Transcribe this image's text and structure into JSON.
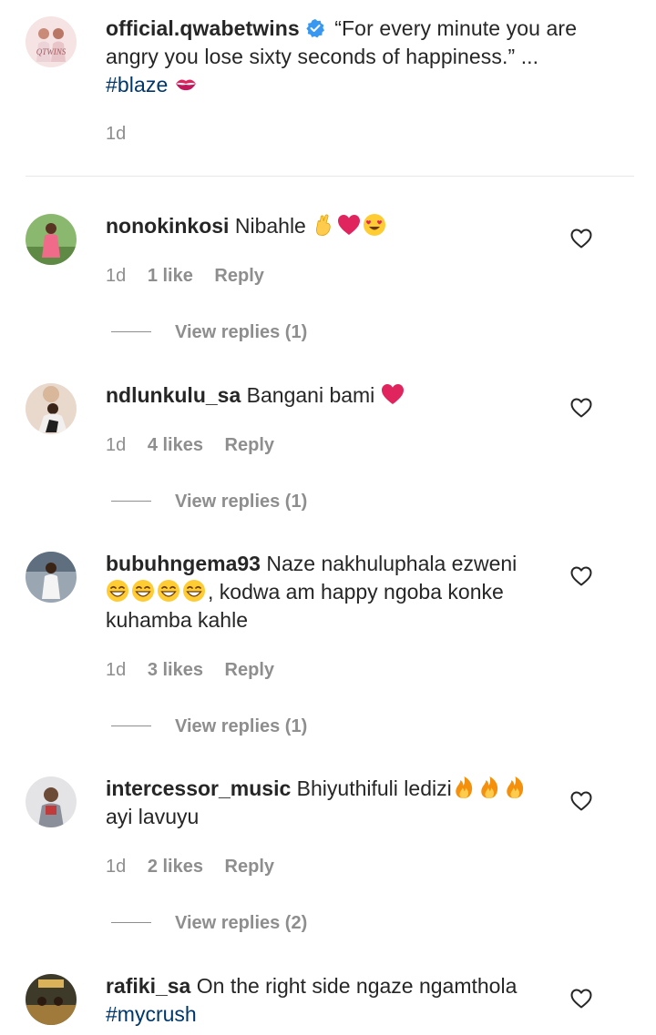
{
  "caption": {
    "username": "official.qwabetwins",
    "text": "“For every minute you are angry you lose sixty seconds of happiness.” ...",
    "hashtag": "#blaze",
    "time": "1d",
    "avatar_text": "QTWINS"
  },
  "comments": [
    {
      "username": "nonokinkosi",
      "text": "Nibahle",
      "emojis": [
        "crossed-fingers",
        "red-heart",
        "heart-eyes"
      ],
      "time": "1d",
      "likes": "1 like",
      "reply": "Reply",
      "view_replies": "View replies (1)"
    },
    {
      "username": "ndlunkulu_sa",
      "text": "Bangani bami",
      "emojis": [
        "red-heart"
      ],
      "time": "1d",
      "likes": "4 likes",
      "reply": "Reply",
      "view_replies": "View replies (1)"
    },
    {
      "username": "bubuhngema93",
      "text": "Naze nakhuluphala ezweni",
      "text2": ", kodwa am happy ngoba konke kuhamba kahle",
      "emojis": [
        "grinning-sweat",
        "grinning-sweat",
        "grinning-sweat",
        "grinning-sweat"
      ],
      "time": "1d",
      "likes": "3 likes",
      "reply": "Reply",
      "view_replies": "View replies (1)"
    },
    {
      "username": "intercessor_music",
      "text": "Bhiyuthifuli ledizi",
      "text2": "ayi lavuyu",
      "emojis": [
        "fire",
        "fire",
        "fire"
      ],
      "time": "1d",
      "likes": "2 likes",
      "reply": "Reply",
      "view_replies": "View replies (2)"
    },
    {
      "username": "rafiki_sa",
      "text": "On the right side ngaze ngamthola",
      "hashtag": "#mycrush"
    }
  ],
  "colors": {
    "text": "#262626",
    "secondary": "#8e8e8e",
    "hashtag": "#00376b",
    "verified": "#3897f0"
  }
}
